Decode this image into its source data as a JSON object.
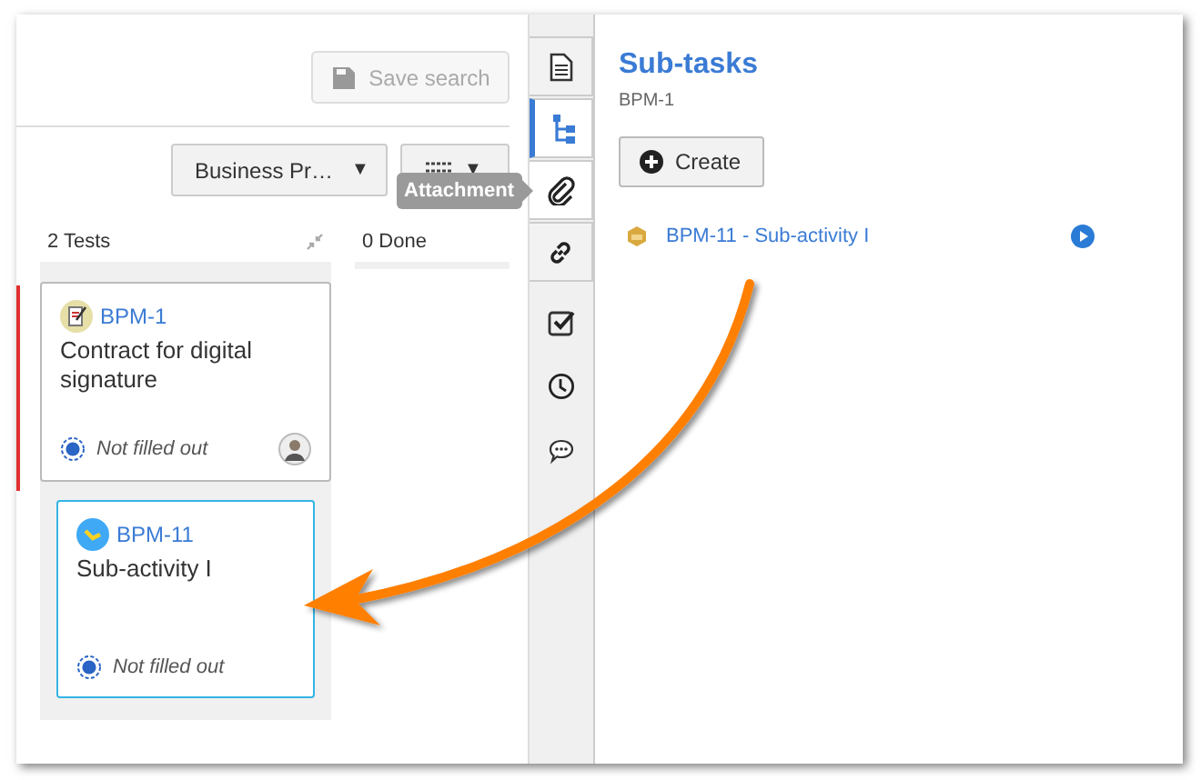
{
  "header": {
    "save_button": {
      "label": "Save search",
      "disabled": true
    }
  },
  "toolbar": {
    "filter_dropdown": {
      "label": "Business Pr…",
      "caret": "▼"
    },
    "view_button": {
      "caret": "▼"
    }
  },
  "tooltip": {
    "text": "Attachment"
  },
  "columns": [
    {
      "heading": "2 Tests",
      "collapsible": true,
      "cards": [
        {
          "kind": "contract",
          "key": "BPM-1",
          "title": "Contract for digital signature",
          "status": "Not filled out",
          "selected": false,
          "assignee": true
        },
        {
          "kind": "subactivity",
          "key": "BPM-11",
          "title": "Sub-activity I",
          "status": "Not filled out",
          "selected": true,
          "assignee": false
        }
      ]
    },
    {
      "heading": "0 Done",
      "collapsible": false
    }
  ],
  "side_tabs": [
    {
      "kind": "document",
      "selected": false,
      "hovered": false
    },
    {
      "kind": "tree",
      "selected": true,
      "hovered": false
    },
    {
      "kind": "attachment",
      "selected": false,
      "hovered": true
    },
    {
      "kind": "link",
      "selected": false,
      "hovered": false
    }
  ],
  "side_tools": [
    {
      "kind": "checklist"
    },
    {
      "kind": "clock"
    },
    {
      "kind": "chat"
    }
  ],
  "panel": {
    "title": "Sub-tasks",
    "subtitle": "BPM-1",
    "create_button": "Create",
    "subtasks": [
      {
        "label": "BPM-11 - Sub-activity I"
      }
    ]
  }
}
